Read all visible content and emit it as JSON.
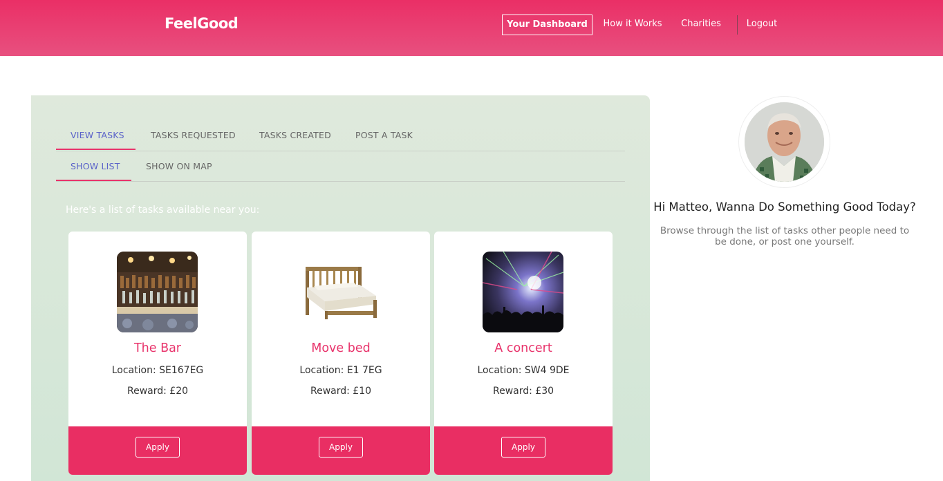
{
  "header": {
    "logo": "FeelGood",
    "nav": {
      "dashboard": "Your Dashboard",
      "how": "How it Works",
      "charities": "Charities",
      "logout": "Logout"
    }
  },
  "tabs": {
    "primary": [
      "VIEW TASKS",
      "TASKS REQUESTED",
      "TASKS CREATED",
      "POST A TASK"
    ],
    "secondary": [
      "SHOW LIST",
      "SHOW ON MAP"
    ]
  },
  "intro": "Here's a list of tasks available near you:",
  "tasks": [
    {
      "title": "The Bar",
      "location": "Location: SE167EG",
      "reward": "Reward: £20",
      "apply": "Apply",
      "image": "bar-photo"
    },
    {
      "title": "Move bed",
      "location": "Location: E1 7EG",
      "reward": "Reward: £10",
      "apply": "Apply",
      "image": "bed-photo"
    },
    {
      "title": "A concert",
      "location": "Location: SW4 9DE",
      "reward": "Reward: £30",
      "apply": "Apply",
      "image": "concert-photo"
    }
  ],
  "sidebar": {
    "greeting": "Hi Matteo, Wanna Do Something Good Today?",
    "subtitle": "Browse through the list of tasks other people need to be done, or post one yourself."
  },
  "colors": {
    "brand": "#e92e63",
    "active_tab": "#5a62c9",
    "panel": "#dce9da"
  }
}
